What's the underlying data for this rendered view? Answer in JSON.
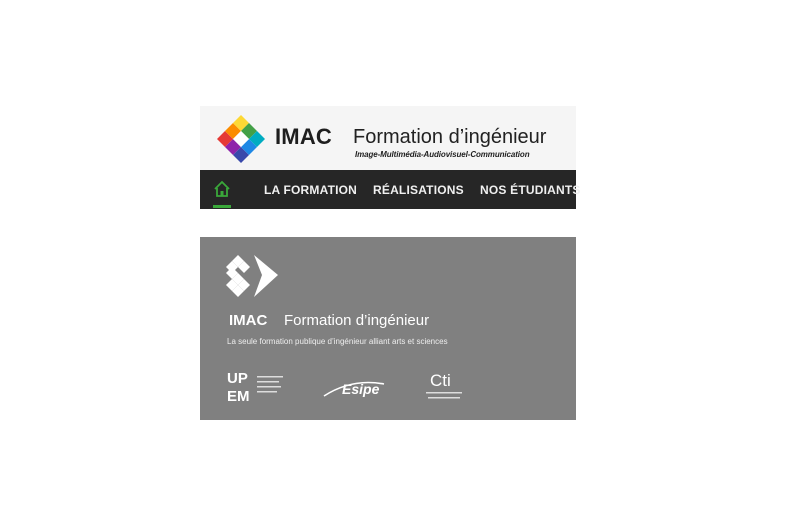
{
  "header": {
    "brand": "IMAC",
    "tagline": "Formation d’ingénieur",
    "subtitle": "Image-Multimédia-Audiovisuel-Communication"
  },
  "nav": {
    "home_icon": "home-icon",
    "items": [
      {
        "label": "LA FORMATION"
      },
      {
        "label": "RÉALISATIONS"
      },
      {
        "label": "NOS ÉTUDIANTS"
      }
    ],
    "active_color": "#3aa83a"
  },
  "footer": {
    "brand": "IMAC",
    "tagline": "Formation d’ingénieur",
    "description": "La seule formation publique d’ingénieur alliant arts et sciences",
    "partners": [
      {
        "name": "UPEM"
      },
      {
        "name": "Esipe"
      },
      {
        "name": "Cti"
      }
    ]
  },
  "colors": {
    "header_bg": "#f5f5f5",
    "nav_bg": "#262626",
    "footer_bg": "#808080"
  }
}
